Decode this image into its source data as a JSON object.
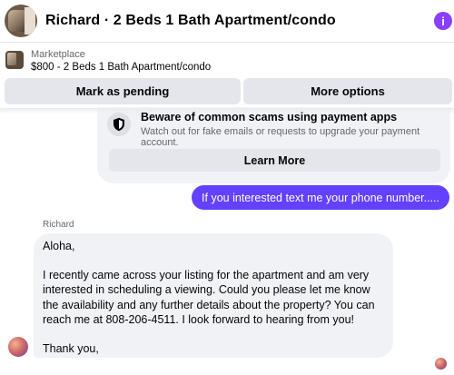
{
  "header": {
    "title": "Richard · 2 Beds 1 Bath Apartment/condo",
    "info_icon": "i"
  },
  "marketplace": {
    "label": "Marketplace",
    "listing": "$800 - 2 Beds 1 Bath Apartment/condo"
  },
  "actions": {
    "mark_pending": "Mark as pending",
    "more_options": "More options"
  },
  "scam_notice": {
    "title": "Beware of common scams using payment apps",
    "subtitle": "Watch out for fake emails or requests to upgrade your payment account.",
    "learn_more": "Learn More",
    "icon": "shield-icon"
  },
  "messages": {
    "outgoing": "If you interested text me your phone number.....",
    "sender_name": "Richard",
    "incoming": {
      "greeting": "Aloha,",
      "body": "I recently came across your listing for the apartment and am very interested in scheduling a viewing. Could you please let me know the availability and any further details about the property? You can reach me at 808-206-4511. I look forward to hearing from you!",
      "closing": "Thank you,"
    }
  },
  "colors": {
    "accent": "#6341ff",
    "info_icon": "#8a3ffc",
    "bubble_gray": "#f0f2f5",
    "button_gray": "#e4e6eb"
  }
}
